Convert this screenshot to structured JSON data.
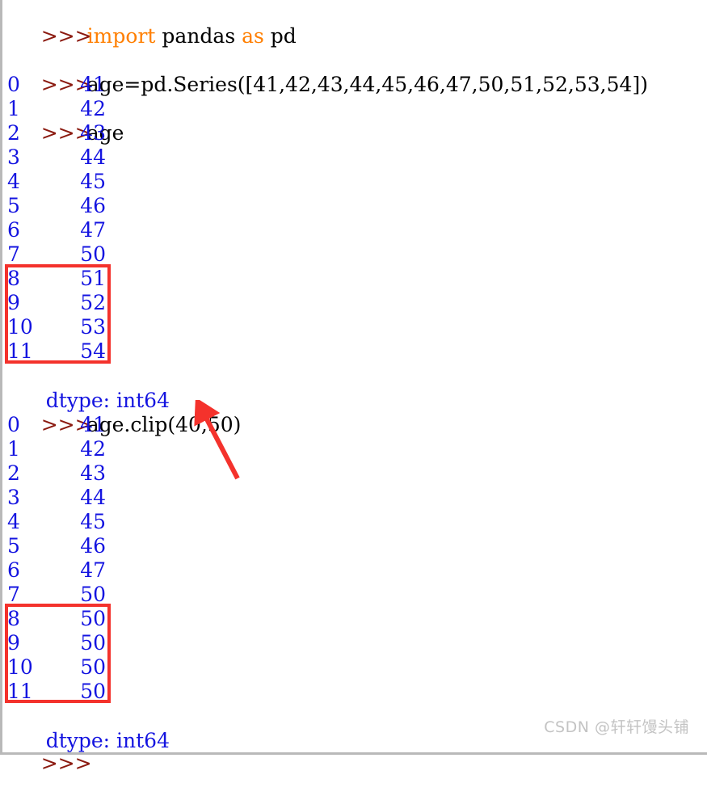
{
  "console": {
    "prompt_symbol": ">>>",
    "prompt_color": "#8b1a10",
    "code_color": "#000000",
    "keyword_color": "#ff7f00",
    "output_color": "#1414e0",
    "highlight_color": "#f4322c",
    "background": "#ffffff"
  },
  "statements": {
    "import_keyword": "import",
    "import_module": " pandas ",
    "as_keyword": "as",
    "import_alias": " pd",
    "series_assignment": "age=pd.Series([41,42,43,44,45,46,47,50,51,52,53,54])",
    "inspect_call": "age",
    "clip_call": "age.clip(40,50)",
    "trailing_prompt": ""
  },
  "series_output": {
    "dtype_line": "dtype: int64",
    "rows": [
      {
        "index": "0",
        "value": "41"
      },
      {
        "index": "1",
        "value": "42"
      },
      {
        "index": "2",
        "value": "43"
      },
      {
        "index": "3",
        "value": "44"
      },
      {
        "index": "4",
        "value": "45"
      },
      {
        "index": "5",
        "value": "46"
      },
      {
        "index": "6",
        "value": "47"
      },
      {
        "index": "7",
        "value": "50"
      },
      {
        "index": "8",
        "value": "51"
      },
      {
        "index": "9",
        "value": "52"
      },
      {
        "index": "10",
        "value": "53"
      },
      {
        "index": "11",
        "value": "54"
      }
    ]
  },
  "clip_output": {
    "dtype_line": "dtype: int64",
    "rows": [
      {
        "index": "0",
        "value": "41"
      },
      {
        "index": "1",
        "value": "42"
      },
      {
        "index": "2",
        "value": "43"
      },
      {
        "index": "3",
        "value": "44"
      },
      {
        "index": "4",
        "value": "45"
      },
      {
        "index": "5",
        "value": "46"
      },
      {
        "index": "6",
        "value": "47"
      },
      {
        "index": "7",
        "value": "50"
      },
      {
        "index": "8",
        "value": "50"
      },
      {
        "index": "9",
        "value": "50"
      },
      {
        "index": "10",
        "value": "50"
      },
      {
        "index": "11",
        "value": "50"
      }
    ]
  },
  "annotations": {
    "box_before_label": "highlight-rows-8-to-11-original",
    "box_after_label": "highlight-rows-8-to-11-clipped",
    "arrow_label": "arrow-pointing-to-clip-arguments"
  },
  "watermark": {
    "text": "CSDN @轩轩馒头铺"
  }
}
